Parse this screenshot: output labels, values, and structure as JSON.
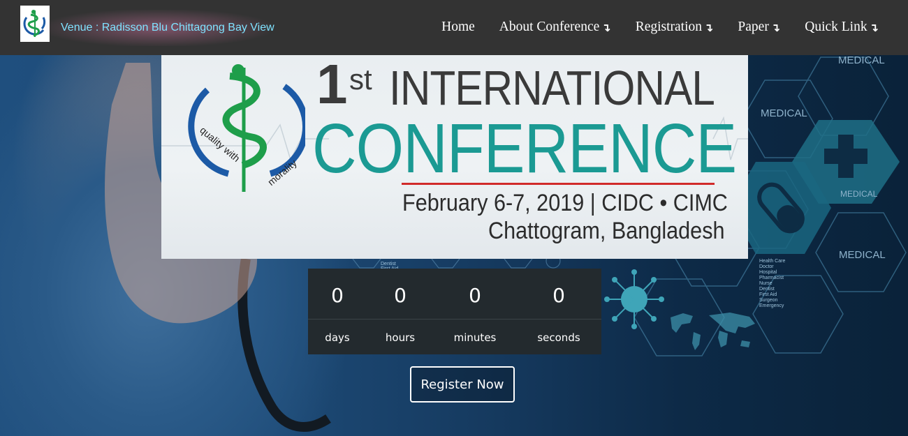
{
  "header": {
    "venue": "Venue : Radisson Blu Chittagong Bay View",
    "nav": [
      {
        "label": "Home",
        "has_dropdown": false
      },
      {
        "label": "About Conference",
        "has_dropdown": true
      },
      {
        "label": "Registration",
        "has_dropdown": true
      },
      {
        "label": "Paper",
        "has_dropdown": true
      },
      {
        "label": "Quick Link",
        "has_dropdown": true
      }
    ],
    "dropdown_arrow": "↴"
  },
  "banner": {
    "ordinal_number": "1",
    "ordinal_suffix": "st",
    "title_line1": "INTERNATIONAL",
    "title_line2": "CONFERENCE",
    "date_line": "February 6-7, 2019 | CIDC • CIMC",
    "location_line": "Chattogram, Bangladesh",
    "logo_text_left": "quality with",
    "logo_text_right": "morality"
  },
  "countdown": {
    "days": "0",
    "hours": "0",
    "minutes": "0",
    "seconds": "0",
    "days_label": "days",
    "hours_label": "hours",
    "minutes_label": "minutes",
    "seconds_label": "seconds"
  },
  "cta": {
    "register_label": "Register Now"
  },
  "background": {
    "hex_labels": [
      "MEDICAL",
      "MEDICAL",
      "MEDICAL",
      "MEDICAL"
    ],
    "small_list": [
      "Health Care",
      "Doctor",
      "Hospital",
      "Pharmacist",
      "Nurse",
      "Dentist",
      "First Aid",
      "Surgeon",
      "Emergency"
    ],
    "mid_list": [
      "Dentist",
      "First Aid"
    ]
  },
  "colors": {
    "navbar": "#333333",
    "venue_text": "#7fe3ff",
    "conference_teal": "#1b9a93",
    "countdown_bg": "#232a2e"
  }
}
